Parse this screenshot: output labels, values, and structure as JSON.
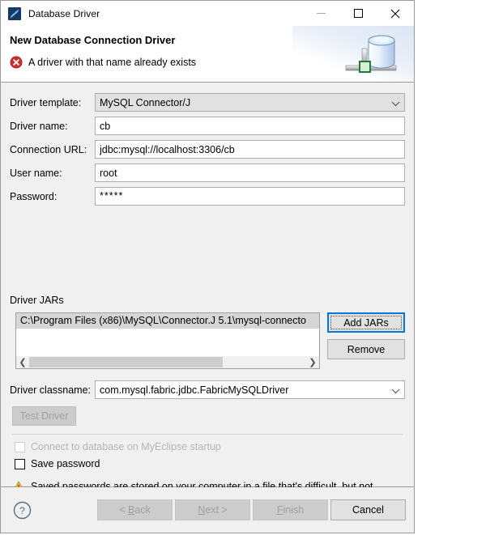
{
  "window": {
    "title": "Database Driver",
    "app_icon": "myeclipse-icon",
    "buttons": {
      "minimize": "minimize-icon",
      "maximize": "maximize-icon",
      "close": "close-icon"
    }
  },
  "header": {
    "title": "New Database Connection Driver",
    "status_icon": "error-icon",
    "status_message": "A driver with that name already exists",
    "graphic": "database-cylinder-icon",
    "error_color": "#d22b2b"
  },
  "form": {
    "driver_template": {
      "label": "Driver template:",
      "value": "MySQL Connector/J"
    },
    "driver_name": {
      "label": "Driver name:",
      "value": "cb"
    },
    "connection_url": {
      "label": "Connection URL:",
      "value": "jdbc:mysql://localhost:3306/cb"
    },
    "user_name": {
      "label": "User name:",
      "value": "root"
    },
    "password": {
      "label": "Password:",
      "value": "*****"
    }
  },
  "driver_jars": {
    "label": "Driver JARs",
    "items": [
      "C:\\Program Files (x86)\\MySQL\\Connector.J 5.1\\mysql-connecto"
    ],
    "scroll_left_icon": "chevron-left-icon",
    "scroll_right_icon": "chevron-right-icon",
    "add_button": "Add JARs",
    "remove_button": "Remove"
  },
  "driver_classname": {
    "label": "Driver classname:",
    "value": "com.mysql.fabric.jdbc.FabricMySQLDriver"
  },
  "test_driver_button": "Test Driver",
  "options": {
    "connect_on_startup": {
      "label": "Connect to database on MyEclipse startup",
      "checked": false,
      "enabled": false
    },
    "save_password": {
      "label": "Save password",
      "checked": false,
      "enabled": true
    }
  },
  "warning": {
    "icon": "warning-triangle-icon",
    "text": "Saved passwords are stored on your computer in a file that's difficult, but not impossible, for an intruder to read."
  },
  "footer": {
    "help_icon": "help-icon",
    "back": {
      "prefix": "< ",
      "mnemonic": "B",
      "suffix": "ack"
    },
    "next": {
      "prefix": "",
      "mnemonic": "N",
      "suffix": "ext >"
    },
    "finish": {
      "prefix": "",
      "mnemonic": "F",
      "suffix": "inish"
    },
    "cancel": "Cancel"
  }
}
